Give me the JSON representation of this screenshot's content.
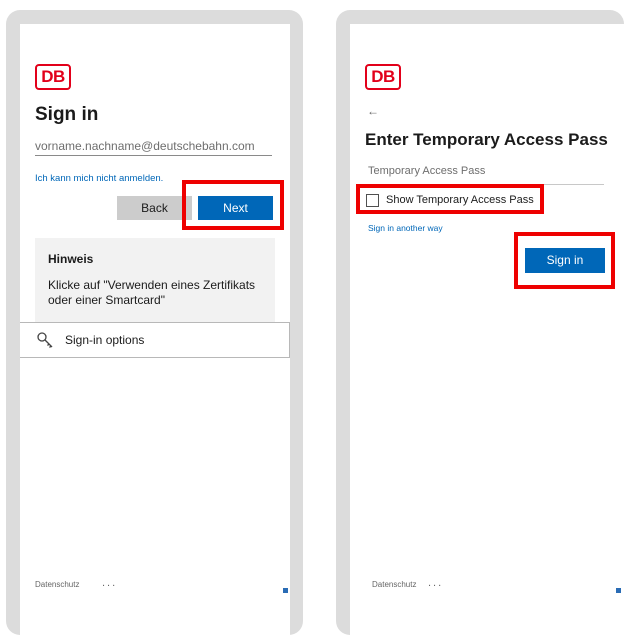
{
  "left_panel": {
    "logo": "DB",
    "title": "Sign in",
    "email_placeholder": "vorname.nachname@deutschebahn.com",
    "cant_sign_in_link": "Ich kann mich nicht anmelden.",
    "back_label": "Back",
    "next_label": "Next",
    "hint": {
      "title": "Hinweis",
      "text": "Klicke auf \"Verwenden eines Zertifikats oder einer Smartcard\""
    },
    "signin_options_label": "Sign-in options",
    "footer_privacy": "Datenschutz",
    "footer_more": "..."
  },
  "right_panel": {
    "logo": "DB",
    "back_arrow": "←",
    "title": "Enter Temporary Access Pass",
    "tap_placeholder": "Temporary Access Pass",
    "show_tap_label": "Show Temporary Access Pass",
    "show_tap_checked": false,
    "another_way_link": "Sign in another way",
    "signin_label": "Sign in",
    "footer_privacy": "Datenschutz",
    "footer_more": "..."
  },
  "icons": {
    "signin_options": "key-icon",
    "back": "back-arrow-icon",
    "footer": "lock-icon"
  },
  "colors": {
    "db_red": "#e2001a",
    "primary_blue": "#0067b8",
    "highlight": "#ee0000",
    "frame": "#dcdcdc"
  }
}
